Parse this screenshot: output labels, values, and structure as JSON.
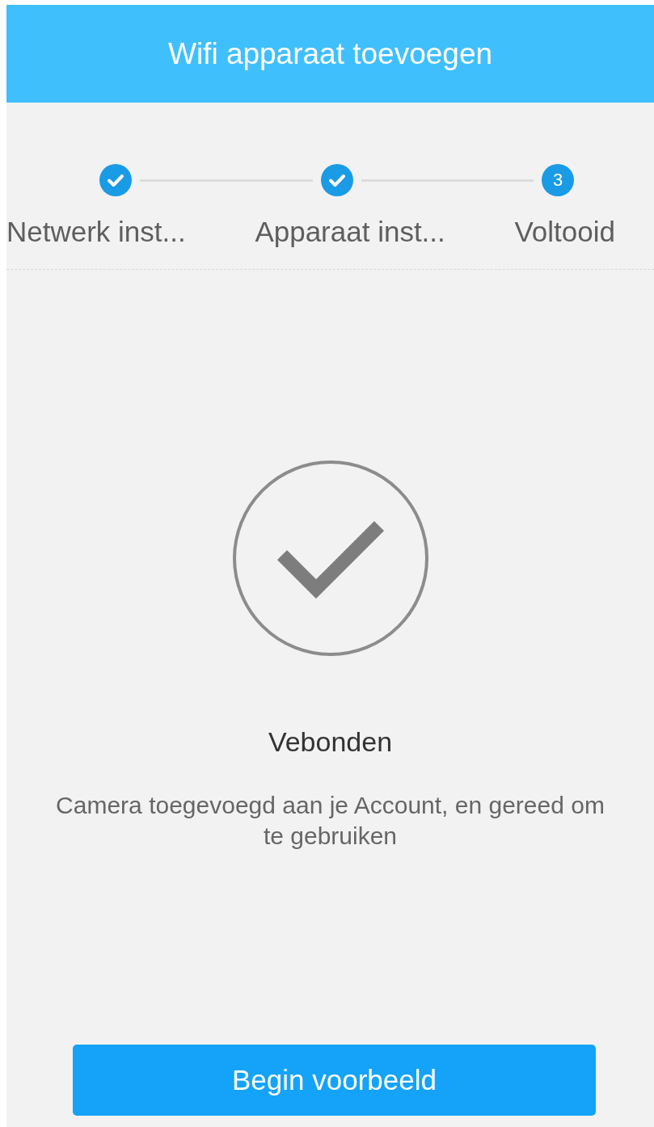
{
  "header": {
    "title": "Wifi apparaat toevoegen"
  },
  "steps": [
    {
      "label": "Netwerk inst...",
      "kind": "done"
    },
    {
      "label": "Apparaat inst...",
      "kind": "done"
    },
    {
      "label": "Voltooid",
      "kind": "current",
      "number": "3"
    }
  ],
  "result": {
    "title": "Vebonden",
    "message": "Camera toegevoegd aan je Account, en gereed om te gebruiken"
  },
  "button": {
    "label": "Begin voorbeeld"
  }
}
